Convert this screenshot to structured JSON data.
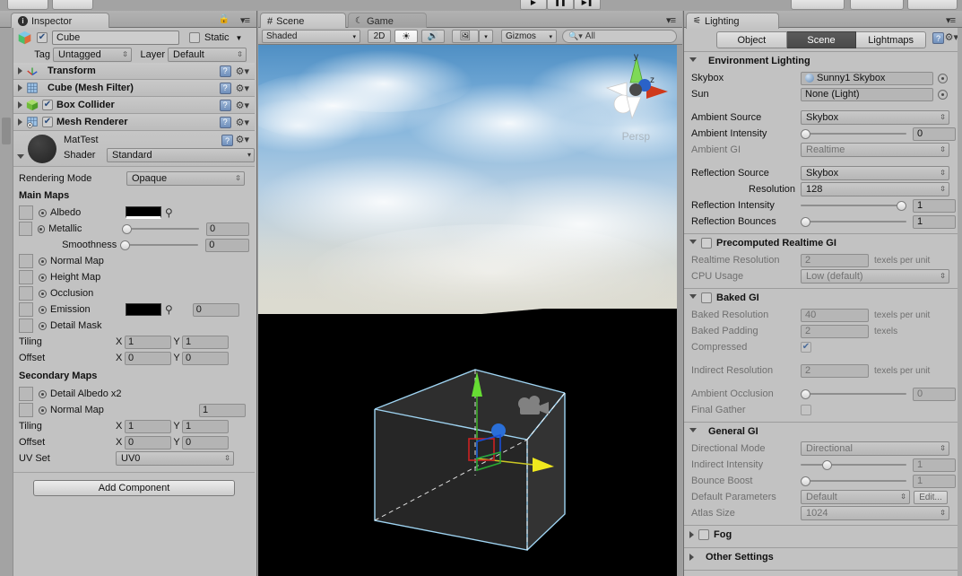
{
  "window": {
    "top_toolbar_visible": true
  },
  "inspector": {
    "tab_label": "Inspector",
    "tab_icon": "info-icon",
    "object_name": "Cube",
    "object_enabled": true,
    "static_label": "Static",
    "static_checked": false,
    "tag_label": "Tag",
    "tag_value": "Untagged",
    "layer_label": "Layer",
    "layer_value": "Default",
    "components": [
      {
        "name": "Transform",
        "icon": "axis-icon",
        "has_checkbox": false,
        "checked": false
      },
      {
        "name": "Cube (Mesh Filter)",
        "icon": "mesh-filter-icon",
        "has_checkbox": false,
        "checked": false
      },
      {
        "name": "Box Collider",
        "icon": "box-collider-icon",
        "has_checkbox": true,
        "checked": true
      },
      {
        "name": "Mesh Renderer",
        "icon": "mesh-renderer-icon",
        "has_checkbox": true,
        "checked": true
      }
    ],
    "material": {
      "name": "MatTest",
      "shader_label": "Shader",
      "shader_value": "Standard",
      "preview_color": "#2b2b2b"
    },
    "rendering_mode_label": "Rendering Mode",
    "rendering_mode_value": "Opaque",
    "main_maps_header": "Main Maps",
    "main_maps": [
      {
        "label": "Albedo",
        "type": "color",
        "color": "#000000",
        "value": ""
      },
      {
        "label": "Metallic",
        "type": "slider",
        "value": "0",
        "fill": 0
      },
      {
        "label": "Smoothness",
        "type": "slider",
        "value": "0",
        "fill": 0,
        "indent": true,
        "no_slot": true
      },
      {
        "label": "Normal Map",
        "type": "slot",
        "value": ""
      },
      {
        "label": "Height Map",
        "type": "slot",
        "value": ""
      },
      {
        "label": "Occlusion",
        "type": "slot",
        "value": ""
      },
      {
        "label": "Emission",
        "type": "color",
        "color": "#000000",
        "value": "0"
      },
      {
        "label": "Detail Mask",
        "type": "slot",
        "value": ""
      }
    ],
    "tiling_label": "Tiling",
    "offset_label": "Offset",
    "axis_x": "X",
    "axis_y": "Y",
    "main_tiling": {
      "x": "1",
      "y": "1"
    },
    "main_offset": {
      "x": "0",
      "y": "0"
    },
    "secondary_maps_header": "Secondary Maps",
    "secondary_maps": [
      {
        "label": "Detail Albedo x2",
        "value": ""
      },
      {
        "label": "Normal Map",
        "value": "1"
      }
    ],
    "secondary_tiling": {
      "x": "1",
      "y": "1"
    },
    "secondary_offset": {
      "x": "0",
      "y": "0"
    },
    "uv_set_label": "UV Set",
    "uv_set_value": "UV0",
    "add_component_label": "Add Component"
  },
  "scene": {
    "tabs": [
      {
        "label": "Scene",
        "icon": "grid-icon",
        "active": true
      },
      {
        "label": "Game",
        "icon": "gamepad-icon",
        "active": false
      }
    ],
    "toolbar": {
      "draw_mode": "Shaded",
      "toggle_2d": "2D",
      "light_icon": "sun-icon",
      "audio_icon": "speaker-icon",
      "fx_icon": "image-icon",
      "fx_dropdown_icon": "chevron-down-icon",
      "gizmos": "Gizmos",
      "search_placeholder": "All",
      "search_icon": "search-icon"
    },
    "viewport": {
      "persp_label": "Persp",
      "gizmo_axis_y": "y",
      "gizmo_axis_z": "z",
      "sky_top_color": "#6ea3d0",
      "ground_color": "#000000",
      "selection_outline_color": "#9fd4f2",
      "handle_y_color": "#66dd33",
      "handle_x_color": "#e8e22a",
      "handle_z_color": "#2a6fd8"
    }
  },
  "lighting": {
    "tab_label": "Lighting",
    "tab_icon": "lighting-icon",
    "modes": [
      {
        "label": "Object",
        "active": false
      },
      {
        "label": "Scene",
        "active": true
      },
      {
        "label": "Lightmaps",
        "active": false
      }
    ],
    "help_icon": "help-icon",
    "gear_icon": "gear-icon",
    "sections": [
      {
        "title": "Environment Lighting",
        "expanded": true,
        "has_checkbox": false,
        "rows": [
          {
            "label": "Skybox",
            "type": "object",
            "value": "Sunny1 Skybox",
            "icon": "sphere-icon",
            "picker": true
          },
          {
            "label": "Sun",
            "type": "object",
            "value": "None (Light)",
            "icon": "",
            "picker": true
          },
          {
            "label": "",
            "type": "spacer"
          },
          {
            "label": "Ambient Source",
            "type": "dropdown",
            "value": "Skybox"
          },
          {
            "label": "Ambient Intensity",
            "type": "slider",
            "value": "0",
            "fill": 0
          },
          {
            "label": "Ambient GI",
            "type": "dropdown",
            "value": "Realtime",
            "disabled": true
          },
          {
            "label": "",
            "type": "spacer"
          },
          {
            "label": "Reflection Source",
            "type": "dropdown",
            "value": "Skybox"
          },
          {
            "label": "Resolution",
            "type": "dropdown",
            "value": "128",
            "indent": true
          },
          {
            "label": "Reflection Intensity",
            "type": "slider",
            "value": "1",
            "fill": 100
          },
          {
            "label": "Reflection Bounces",
            "type": "slider",
            "value": "1",
            "fill": 0
          }
        ]
      },
      {
        "title": "Precomputed Realtime GI",
        "expanded": true,
        "has_checkbox": true,
        "checked": false,
        "rows": [
          {
            "label": "Realtime Resolution",
            "type": "field",
            "value": "2",
            "suffix": "texels per unit",
            "disabled": true
          },
          {
            "label": "CPU Usage",
            "type": "dropdown",
            "value": "Low (default)",
            "disabled": true
          }
        ]
      },
      {
        "title": "Baked GI",
        "expanded": true,
        "has_checkbox": true,
        "checked": false,
        "rows": [
          {
            "label": "Baked Resolution",
            "type": "field",
            "value": "40",
            "suffix": "texels per unit",
            "disabled": true
          },
          {
            "label": "Baked Padding",
            "type": "field",
            "value": "2",
            "suffix": "texels",
            "disabled": true
          },
          {
            "label": "Compressed",
            "type": "checkbox",
            "checked": true,
            "disabled": true
          },
          {
            "label": "",
            "type": "spacer"
          },
          {
            "label": "Indirect Resolution",
            "type": "field",
            "value": "2",
            "suffix": "texels per unit",
            "disabled": true
          },
          {
            "label": "",
            "type": "spacer"
          },
          {
            "label": "Ambient Occlusion",
            "type": "slider",
            "value": "0",
            "fill": 0,
            "disabled": true
          },
          {
            "label": "Final Gather",
            "type": "checkbox",
            "checked": false,
            "disabled": true
          }
        ]
      },
      {
        "title": "General GI",
        "expanded": true,
        "has_checkbox": false,
        "indent_title": true,
        "rows": [
          {
            "label": "Directional Mode",
            "type": "dropdown",
            "value": "Directional",
            "disabled": true
          },
          {
            "label": "Indirect Intensity",
            "type": "slider",
            "value": "1",
            "fill": 22,
            "disabled": true
          },
          {
            "label": "Bounce Boost",
            "type": "slider",
            "value": "1",
            "fill": 0,
            "disabled": true
          },
          {
            "label": "Default Parameters",
            "type": "dropdown_edit",
            "value": "Default",
            "button": "Edit...",
            "disabled": true
          },
          {
            "label": "Atlas Size",
            "type": "dropdown",
            "value": "1024",
            "disabled": true
          }
        ]
      },
      {
        "title": "Fog",
        "expanded": false,
        "has_checkbox": true,
        "checked": false,
        "rows": []
      },
      {
        "title": "Other Settings",
        "expanded": false,
        "has_checkbox": false,
        "indent_title": true,
        "rows": []
      }
    ]
  }
}
